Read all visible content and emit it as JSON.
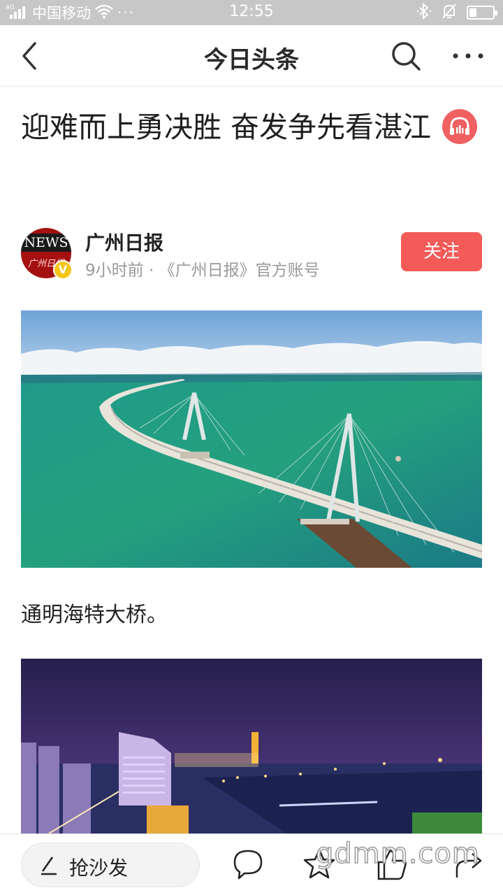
{
  "status_bar": {
    "network": "4G",
    "carrier": "中国移动",
    "more": "···",
    "time": "12:55",
    "battery_level": 0.3
  },
  "nav": {
    "title": "今日头条"
  },
  "article": {
    "title": "迎难而上勇决胜 奋发争先看湛江",
    "author": {
      "name": "广州日报",
      "meta": "9小时前 · 《广州日报》官方账号",
      "avatar_text": "NEWS",
      "avatar_sub": "广州日报",
      "verified_mark": "V"
    },
    "follow_label": "关注",
    "caption_1": "通明海特大桥。"
  },
  "bottom_bar": {
    "comment_placeholder": "抢沙发"
  },
  "watermark": "gdmm.com",
  "colors": {
    "accent": "#f35a58",
    "status_bar": "#c7c7c7"
  }
}
